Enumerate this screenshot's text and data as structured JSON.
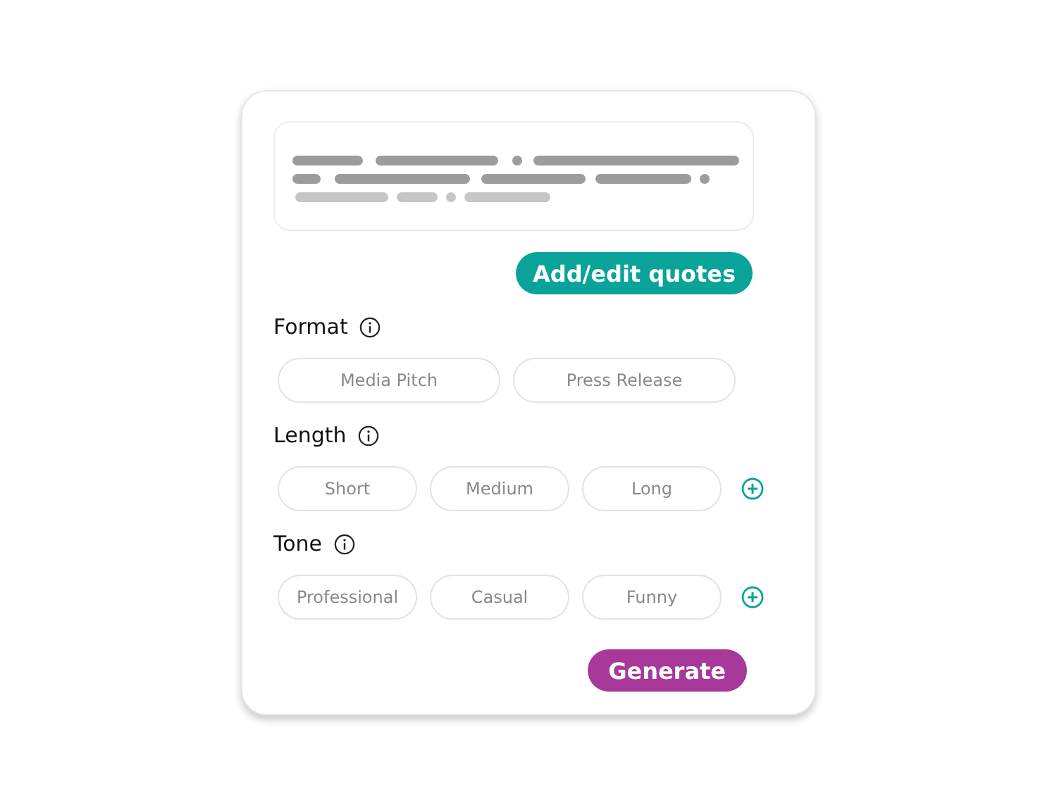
{
  "quotes_button": "Add/edit quotes",
  "sections": [
    {
      "label": "Format",
      "addable": false,
      "options": [
        {
          "label": "Media Pitch",
          "selected": false
        },
        {
          "label": "Press Release",
          "selected": false
        }
      ]
    },
    {
      "label": "Length",
      "addable": true,
      "options": [
        {
          "label": "Short",
          "selected": false
        },
        {
          "label": "Medium",
          "selected": false
        },
        {
          "label": "Long",
          "selected": false
        }
      ]
    },
    {
      "label": "Tone",
      "addable": true,
      "options": [
        {
          "label": "Professional",
          "selected": false
        },
        {
          "label": "Casual",
          "selected": false
        },
        {
          "label": "Funny",
          "selected": false
        }
      ]
    }
  ],
  "generate_button": "Generate"
}
